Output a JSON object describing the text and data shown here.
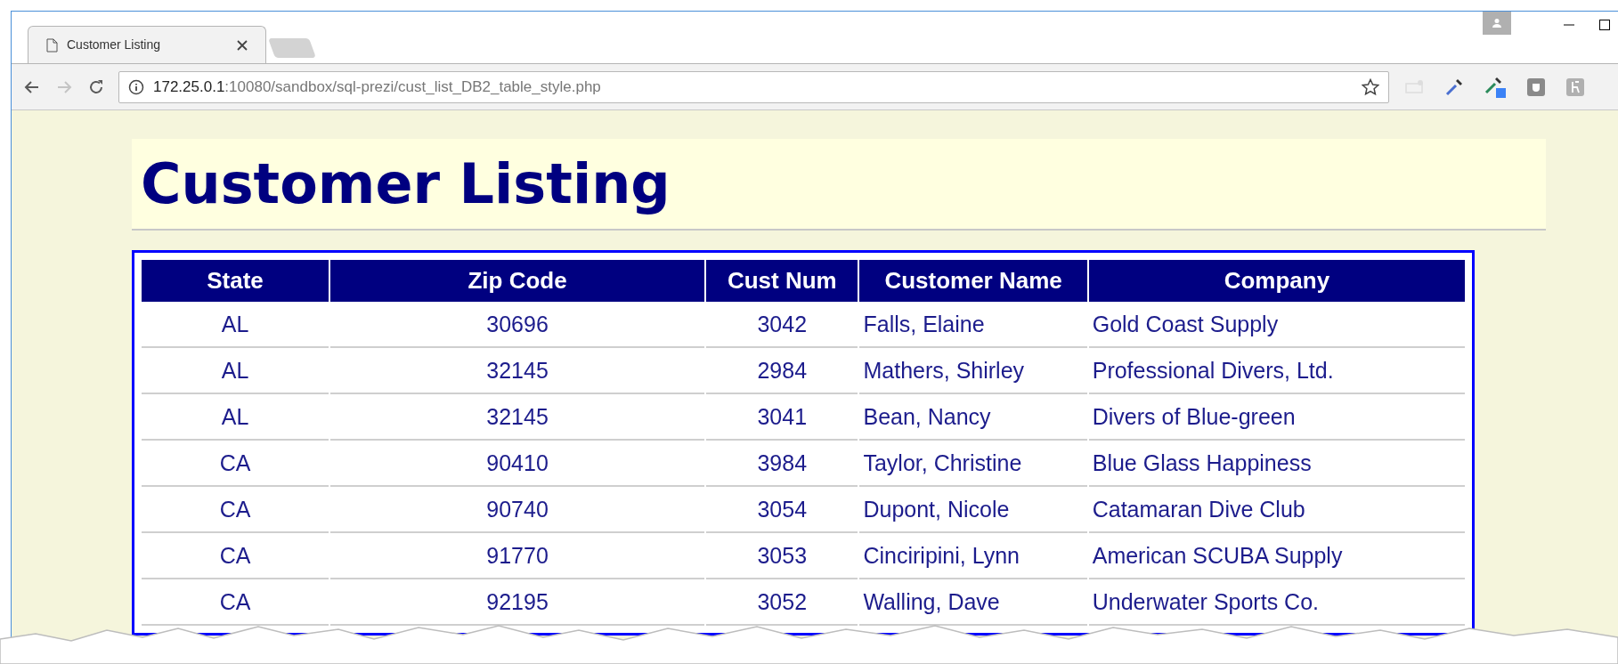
{
  "browser": {
    "tabs": [
      {
        "title": "Customer Listing",
        "selected": true
      }
    ],
    "nav": [
      {
        "kind": "back",
        "disabled": false
      },
      {
        "kind": "forward",
        "disabled": true
      },
      {
        "kind": "reload",
        "disabled": false
      }
    ],
    "url": {
      "host": "172.25.0.1",
      "rest": ":10080/sandbox/sql-prezi/cust_list_DB2_table_style.php"
    }
  },
  "page": {
    "title": "Customer Listing",
    "table": {
      "columns": [
        "State",
        "Zip Code",
        "Cust Num",
        "Customer Name",
        "Company"
      ],
      "rows": [
        [
          "AL",
          "30696",
          "3042",
          "Falls, Elaine",
          "Gold Coast Supply"
        ],
        [
          "AL",
          "32145",
          "2984",
          "Mathers, Shirley",
          "Professional Divers, Ltd."
        ],
        [
          "AL",
          "32145",
          "3041",
          "Bean, Nancy",
          "Divers of Blue-green"
        ],
        [
          "CA",
          "90410",
          "3984",
          "Taylor, Christine",
          "Blue Glass Happiness"
        ],
        [
          "CA",
          "90740",
          "3054",
          "Dupont, Nicole",
          "Catamaran Dive Club"
        ],
        [
          "CA",
          "91770",
          "3053",
          "Cinciripini, Lynn",
          "American SCUBA Supply"
        ],
        [
          "CA",
          "92195",
          "3052",
          "Walling, Dave",
          "Underwater Sports Co."
        ]
      ]
    }
  }
}
